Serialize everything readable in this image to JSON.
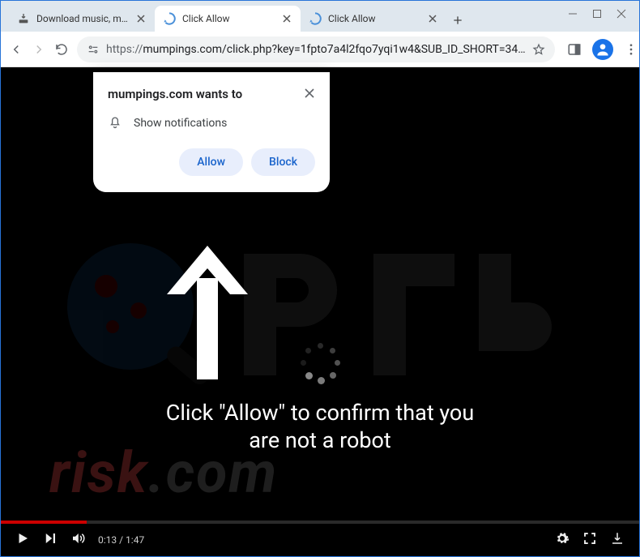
{
  "tabs": [
    {
      "title": "Download music, movi…"
    },
    {
      "title": "Click Allow"
    },
    {
      "title": "Click Allow"
    }
  ],
  "address": {
    "protocol": "https://",
    "rest": "mumpings.com/click.php?key=1fpto7a4l2fqo7yqi1w4&SUB_ID_SHORT=34…"
  },
  "permission": {
    "title": "mumpings.com wants to",
    "item": "Show notifications",
    "allow": "Allow",
    "block": "Block"
  },
  "page": {
    "line1": "Click \"Allow\" to confirm that you",
    "line2": "are not a robot"
  },
  "player": {
    "time": "0:13 / 1:47"
  },
  "watermark": {
    "text_red": "risk",
    "text_grey": ".com"
  }
}
